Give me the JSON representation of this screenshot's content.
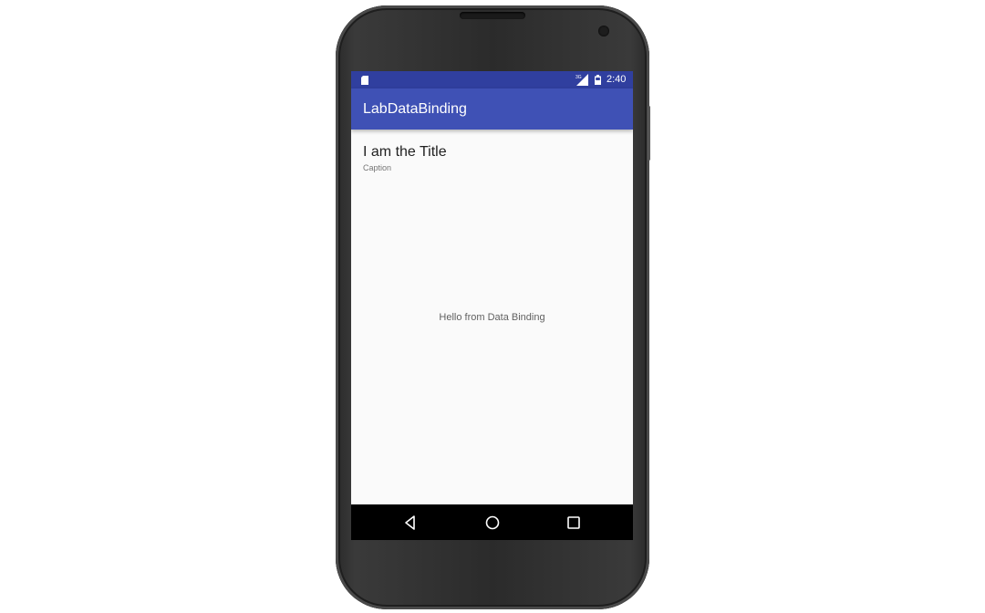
{
  "status_bar": {
    "time": "2:40",
    "network_label": "3G",
    "icons": [
      "sd-card-icon",
      "signal-icon",
      "battery-icon"
    ]
  },
  "app_bar": {
    "title": "LabDataBinding"
  },
  "content": {
    "title": "I am the Title",
    "caption": "Caption",
    "message": "Hello from Data Binding"
  },
  "nav_bar": {
    "buttons": [
      "back-icon",
      "home-icon",
      "recents-icon"
    ]
  },
  "colors": {
    "primary": "#3f51b5",
    "primary_dark": "#303f9f",
    "background": "#fafafa",
    "device_body": "#2b2b2b"
  }
}
